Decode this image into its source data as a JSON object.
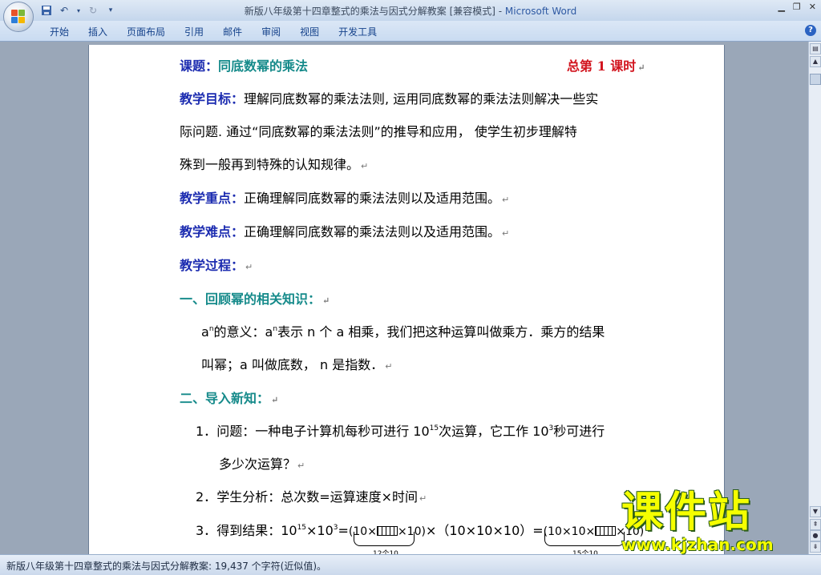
{
  "window": {
    "title": "新版八年级第十四章整式的乘法与因式分解教案 [兼容模式] - ",
    "app": "Microsoft Word"
  },
  "ribbon": {
    "tabs": [
      "开始",
      "插入",
      "页面布局",
      "引用",
      "邮件",
      "审阅",
      "视图",
      "开发工具"
    ]
  },
  "doc": {
    "title_label": "课题：",
    "title_value": "同底数幂的乘法",
    "lesson_count": "总第 1 课时",
    "goal_label": "教学目标：",
    "goal_line1": "理解同底数幂的乘法法则, 运用同底数幂的乘法法则解决一些实",
    "goal_line2": "际问题. 通过“同底数幂的乘法法则”的推导和应用，  使学生初步理解特",
    "goal_line3": "殊到一般再到特殊的认知规律。",
    "focus_label": "教学重点：",
    "focus_text": "正确理解同底数幂的乘法法则以及适用范围。",
    "difficulty_label": "教学难点：",
    "difficulty_text": "正确理解同底数幂的乘法法则以及适用范围。",
    "process_label": "教学过程：",
    "section1": "一、回顾幂的相关知识：",
    "s1_a1": "a",
    "s1_sup1": "n",
    "s1_t1": "的意义：a",
    "s1_sup2": "n",
    "s1_t2": "表示 n 个 a 相乘，我们把这种运算叫做乘方．乘方的结果",
    "s1_line2": "叫幂；a 叫做底数，  n 是指数．",
    "section2": "二、导入新知：",
    "item1_num": "1．",
    "item1_a": "问题：一种电子计算机每秒可进行 10",
    "item1_sup1": "15",
    "item1_b": "次运算，它工作 10",
    "item1_sup2": "3",
    "item1_c": "秒可进行",
    "item1_line2": "多少次运算？",
    "item2_num": "2．",
    "item2_text": "学生分析：总次数=运算速度×时间",
    "item3_num": "3．",
    "item3_a": "得到结果：10",
    "item3_sup1": "15",
    "item3_b": "×10",
    "item3_sup2": "3",
    "item3_c": "=",
    "item3_g1": "(10×",
    "item3_g1b": "×10)",
    "item3_mid": "×（10×10×10）=",
    "item3_g2": "(10×10×",
    "item3_g2b": "×10)",
    "brace1_label": "12个10",
    "brace2_label": "15个10"
  },
  "status": {
    "text": "新版八年级第十四章整式的乘法与因式分解教案: 19,437 个字符(近似值)。"
  },
  "watermark": {
    "cn": "课件站",
    "url": "www.kjzhan.com"
  },
  "colors": {
    "label_blue": "#1c2cb0",
    "section_teal": "#158a8a",
    "lesson_red": "#d2141e",
    "watermark_yellow": "#f5ff00"
  }
}
